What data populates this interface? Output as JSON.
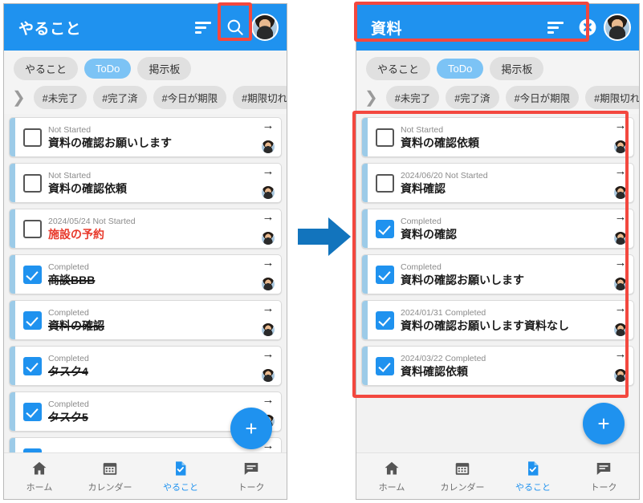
{
  "colors": {
    "brand_blue": "#1f92ef",
    "chip_active": "#7cc3f5",
    "highlight_red": "#f3483f",
    "overdue_red": "#e8392b",
    "accent_bar": "#9ccbe8",
    "arrow_blue": "#1274bd"
  },
  "panels": [
    {
      "id": "before",
      "header": {
        "title": "やること",
        "sort_icon": "sort-icon",
        "action_icon": "search-icon",
        "avatar": "avatar"
      },
      "tabs": [
        {
          "label": "やること",
          "active": false
        },
        {
          "label": "ToDo",
          "active": true
        },
        {
          "label": "掲示板",
          "active": false
        }
      ],
      "filters": [
        {
          "label": "#未完了"
        },
        {
          "label": "#完了済"
        },
        {
          "label": "#今日が期限"
        },
        {
          "label": "#期限切れ"
        }
      ],
      "filter_expand_icon": "chevron-right-icon",
      "tasks": [
        {
          "meta": "Not Started",
          "title": "資料の確認お願いします",
          "checked": false,
          "overdue": false
        },
        {
          "meta": "Not Started",
          "title": "資料の確認依頼",
          "checked": false,
          "overdue": false
        },
        {
          "meta": "2024/05/24 Not Started",
          "title": "施設の予約",
          "checked": false,
          "overdue": true
        },
        {
          "meta": "Completed",
          "title": "商談BBB",
          "checked": true,
          "overdue": false
        },
        {
          "meta": "Completed",
          "title": "資料の確認",
          "checked": true,
          "overdue": false
        },
        {
          "meta": "Completed",
          "title": "タスク4",
          "checked": true,
          "overdue": false
        },
        {
          "meta": "Completed",
          "title": "タスク5",
          "checked": true,
          "overdue": false
        },
        {
          "meta": "Completed",
          "title": "",
          "checked": true,
          "overdue": false
        }
      ],
      "fab_label": "+",
      "bottom_nav": [
        {
          "label": "ホーム",
          "icon": "home-icon",
          "active": false
        },
        {
          "label": "カレンダー",
          "icon": "calendar-icon",
          "active": false
        },
        {
          "label": "やること",
          "icon": "todo-document-icon",
          "active": true
        },
        {
          "label": "トーク",
          "icon": "chat-icon",
          "active": false
        }
      ]
    },
    {
      "id": "after",
      "header": {
        "title": "資料",
        "sort_icon": "sort-icon",
        "action_icon": "close-circle-icon",
        "avatar": "avatar"
      },
      "tabs": [
        {
          "label": "やること",
          "active": false
        },
        {
          "label": "ToDo",
          "active": true
        },
        {
          "label": "掲示板",
          "active": false
        }
      ],
      "filters": [
        {
          "label": "#未完了"
        },
        {
          "label": "#完了済"
        },
        {
          "label": "#今日が期限"
        },
        {
          "label": "#期限切れ"
        }
      ],
      "filter_expand_icon": "chevron-right-icon",
      "tasks": [
        {
          "meta": "Not Started",
          "title": "資料の確認依頼",
          "checked": false,
          "overdue": false
        },
        {
          "meta": "2024/06/20 Not Started",
          "title": "資料確認",
          "checked": false,
          "overdue": false
        },
        {
          "meta": "Completed",
          "title": "資料の確認",
          "checked": true,
          "overdue": false
        },
        {
          "meta": "Completed",
          "title": "資料の確認お願いします",
          "checked": true,
          "overdue": false
        },
        {
          "meta": "2024/01/31 Completed",
          "title": "資料の確認お願いします資料なし",
          "checked": true,
          "overdue": false
        },
        {
          "meta": "2024/03/22 Completed",
          "title": "資料確認依頼",
          "checked": true,
          "overdue": false
        }
      ],
      "fab_label": "+",
      "bottom_nav": [
        {
          "label": "ホーム",
          "icon": "home-icon",
          "active": false
        },
        {
          "label": "カレンダー",
          "icon": "calendar-icon",
          "active": false
        },
        {
          "label": "やること",
          "icon": "todo-document-icon",
          "active": true
        },
        {
          "label": "トーク",
          "icon": "chat-icon",
          "active": false
        }
      ]
    }
  ],
  "annotations": {
    "search_highlight": "search-icon-highlight",
    "header_highlight": "search-header-highlight",
    "results_highlight": "filtered-results-highlight",
    "flow_arrow": "flow-arrow-right"
  }
}
